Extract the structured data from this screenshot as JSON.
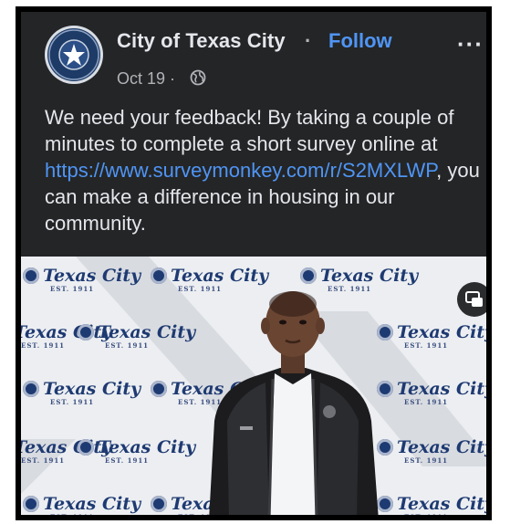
{
  "post": {
    "page_name": "City of Texas City",
    "separator": "·",
    "follow_label": "Follow",
    "more_label": "···",
    "date": "Oct 19 ·",
    "audience_icon": "globe-icon",
    "text_before_link": "We need your feedback! By taking a couple of minutes to complete a short survey online at ",
    "link_text": "https://www.surveymonkey.com/r/S2MXLWP",
    "text_after_link": ", you can make a difference in housing in our community.",
    "avatar_icon": "city-seal-logo"
  },
  "media": {
    "backdrop_text": "Texas City",
    "backdrop_subtext": "EST. 1911",
    "pip_icon": "picture-in-picture-icon"
  },
  "colors": {
    "background": "#242526",
    "text": "#e4e6eb",
    "link": "#4f95f5",
    "secondary_text": "#b0b3b8"
  }
}
